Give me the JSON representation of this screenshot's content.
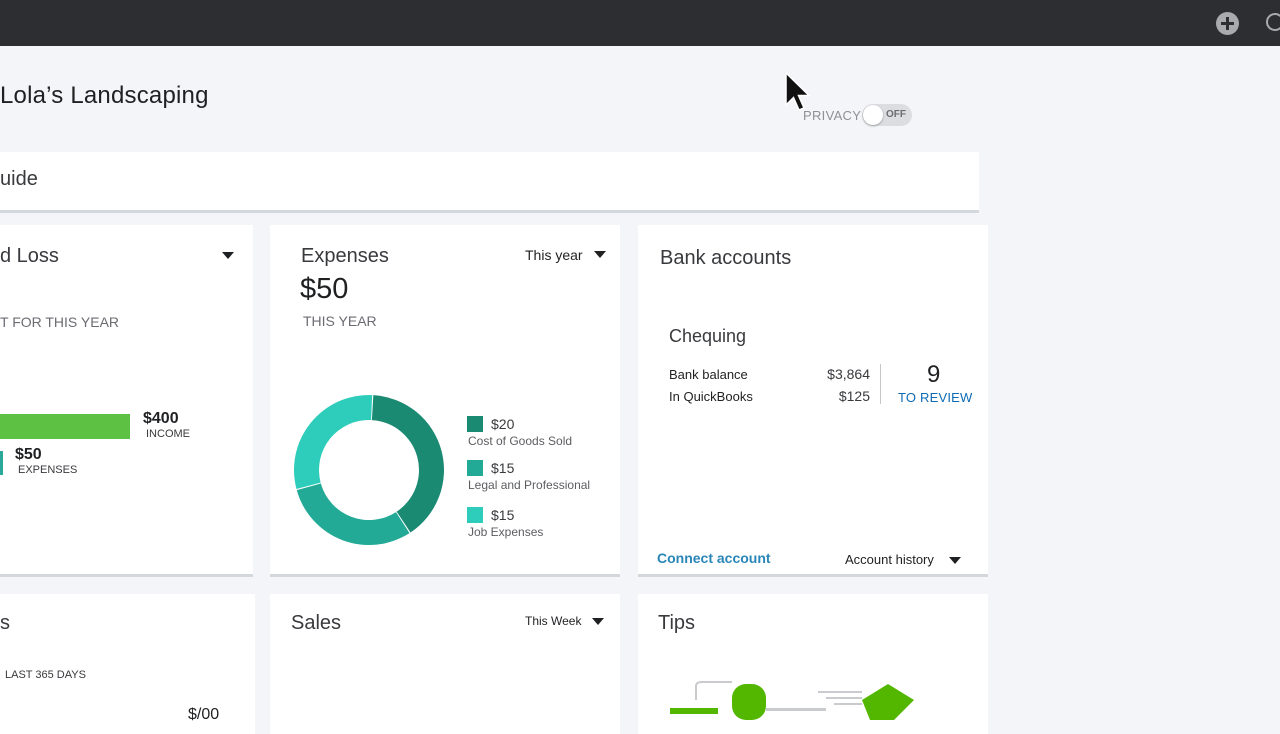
{
  "header": {
    "add_icon": "plus-circle-icon",
    "search_icon": "search-icon"
  },
  "company": {
    "name": "Lola’s Landscaping"
  },
  "privacy": {
    "label": "PRIVACY",
    "state": "OFF"
  },
  "guide": {
    "title_fragment": "uide"
  },
  "profit_loss": {
    "title_fragment": "d Loss",
    "subtitle_fragment": "T FOR THIS YEAR",
    "income_value": "$400",
    "income_label": "INCOME",
    "expenses_value": "$50",
    "expenses_label": "EXPENSES",
    "income_amount": 400,
    "expenses_amount": 50
  },
  "expenses": {
    "title": "Expenses",
    "period": "This year",
    "total": "$50",
    "total_label": "THIS YEAR",
    "colors": [
      "#1b8a73",
      "#22aa96",
      "#2ecdbb"
    ],
    "items": [
      {
        "value": "$20",
        "name": "Cost of Goods Sold",
        "amount": 20
      },
      {
        "value": "$15",
        "name": "Legal and Professional",
        "amount": 15
      },
      {
        "value": "$15",
        "name": "Job Expenses",
        "amount": 15
      }
    ]
  },
  "bank": {
    "title": "Bank accounts",
    "account_name": "Chequing",
    "bank_balance_label": "Bank balance",
    "bank_balance_value": "$3,864",
    "qb_label": "In QuickBooks",
    "qb_value": "$125",
    "review_count": "9",
    "review_label": "TO REVIEW",
    "connect_label": "Connect account",
    "history_label": "Account history"
  },
  "bottom": {
    "left_title_fragment": "s",
    "left_subtitle_fragment": "LAST 365 DAYS",
    "left_value_fragment": "$/00",
    "sales_title": "Sales",
    "sales_period": "This Week",
    "tips_title": "Tips"
  }
}
